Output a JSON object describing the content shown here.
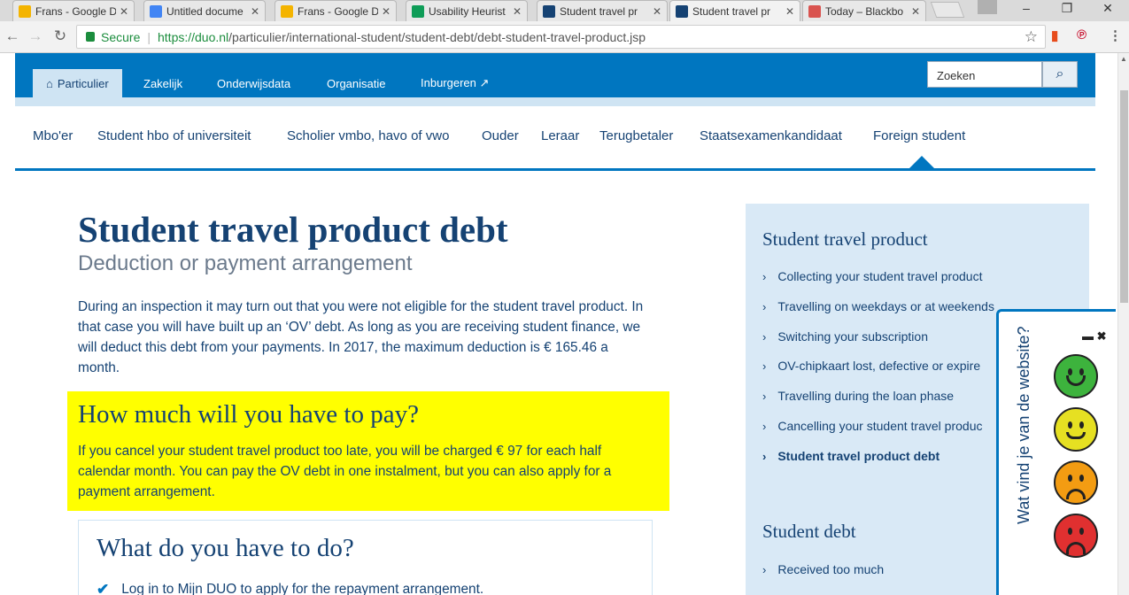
{
  "browser": {
    "tabs": [
      {
        "title": "Frans - Google D",
        "icon": "google-drive-icon",
        "color": "#f4b400",
        "active": false
      },
      {
        "title": "Untitled docume",
        "icon": "google-docs-icon",
        "color": "#4285f4",
        "active": false
      },
      {
        "title": "Frans - Google D",
        "icon": "google-drive-icon",
        "color": "#f4b400",
        "active": false
      },
      {
        "title": "Usability Heurist",
        "icon": "google-sheets-icon",
        "color": "#0f9d58",
        "active": false
      },
      {
        "title": "Student travel pr",
        "icon": "duo-icon",
        "color": "#154273",
        "active": false
      },
      {
        "title": "Student travel pr",
        "icon": "duo-icon",
        "color": "#154273",
        "active": true
      },
      {
        "title": "Today – Blackbo",
        "icon": "blackboard-icon",
        "color": "#d9534f",
        "active": false
      }
    ],
    "secure_label": "Secure",
    "url_host": "https://duo.nl",
    "url_path": "/particulier/international-student/student-debt/debt-student-travel-product.jsp"
  },
  "header": {
    "nav": [
      {
        "label": "Particulier",
        "icon": "home-icon"
      },
      {
        "label": "Zakelijk"
      },
      {
        "label": "Onderwijsdata"
      },
      {
        "label": "Organisatie"
      },
      {
        "label": "Inburgeren ↗"
      }
    ],
    "search_placeholder": "Zoeken"
  },
  "subnav": [
    "Mbo'er",
    "Student hbo of universiteit",
    "Scholier vmbo, havo of vwo",
    "Ouder",
    "Leraar",
    "Terugbetaler",
    "Staatsexamenkandidaat",
    "Foreign student"
  ],
  "main": {
    "title": "Student travel product debt",
    "subtitle": "Deduction or payment arrangement",
    "intro": "During an inspection it may turn out that you were not eligible for the student travel product. In that case you will have built up an ‘OV’ debt. As long as you are receiving student finance, we will deduct this debt from your payments. In 2017, the maximum deduction is € 165.46 a month.",
    "pay_heading": "How much will you have to pay?",
    "pay_text": "If you cancel your student travel product too late, you will be charged € 97 for each half calendar month. You can pay the OV debt in one instalment, but you can also apply for a payment arrangement.",
    "todo_heading": "What do you have to do?",
    "todo_item": "Log in to Mijn DUO to apply for the repayment arrangement."
  },
  "sidebar": {
    "section1_title": "Student travel product",
    "section1_links": [
      "Collecting your student travel product",
      "Travelling on weekdays or at weekends",
      "Switching your subscription",
      "OV-chipkaart lost, defective or expire",
      "Travelling during the loan phase",
      "Cancelling your student travel produc",
      "Student travel product debt"
    ],
    "section2_title": "Student debt",
    "section2_links": [
      "Received too much"
    ]
  },
  "feedback": {
    "question": "Wat vind je van de website?",
    "colors": [
      "#3db33d",
      "#e6e022",
      "#f39c12",
      "#e03030"
    ]
  }
}
